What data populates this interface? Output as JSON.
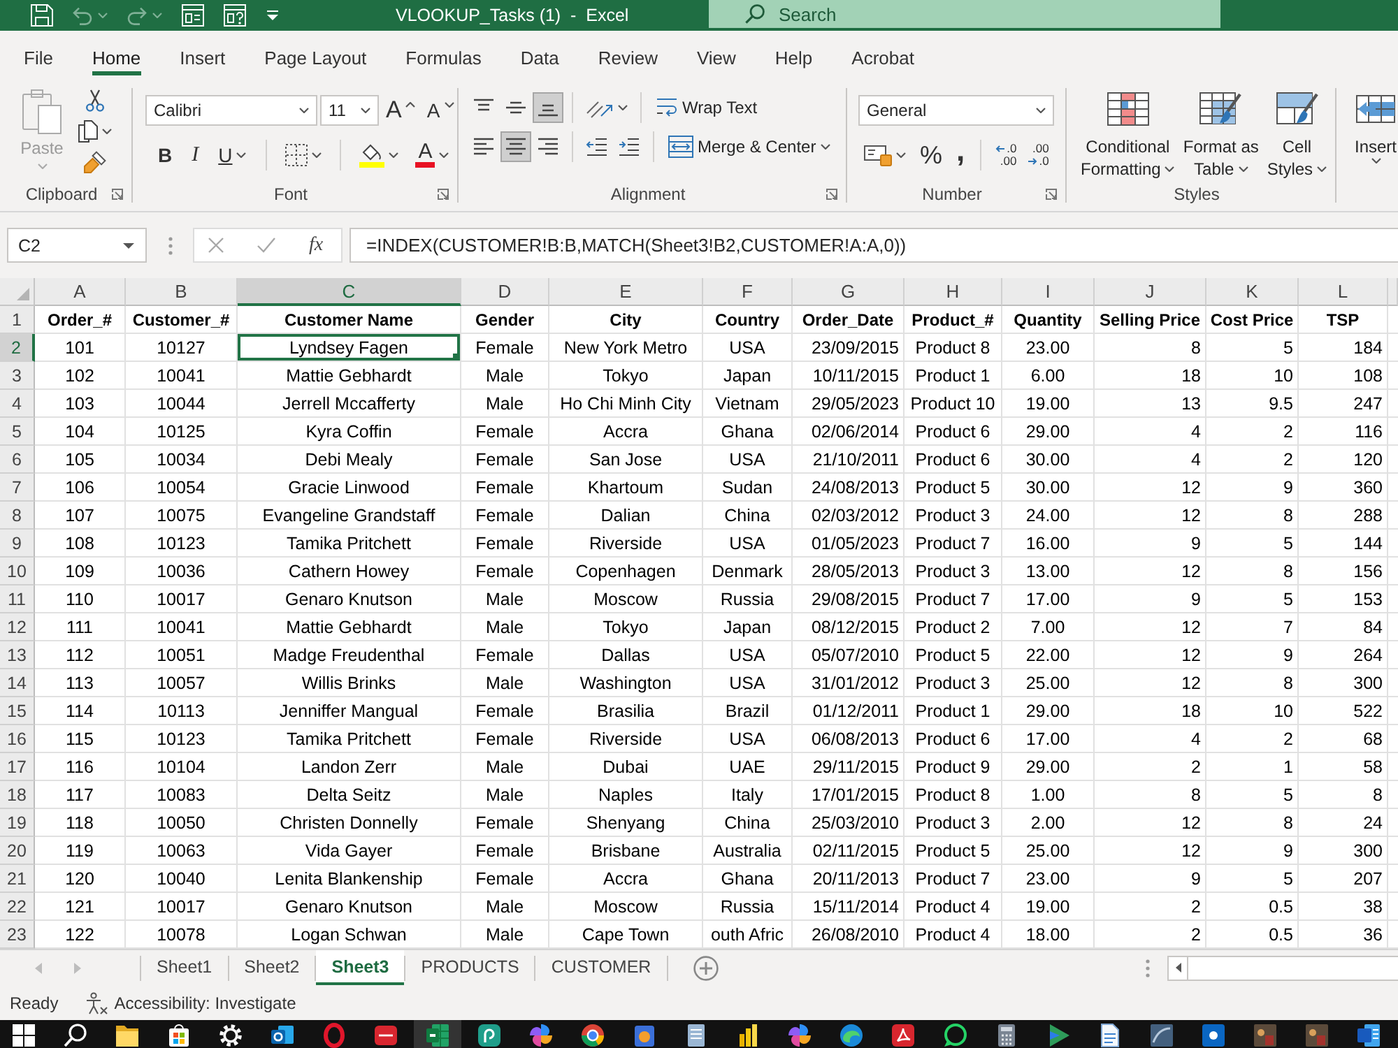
{
  "window": {
    "title": "VLOOKUP_Tasks (1)  -  Excel",
    "search": {
      "placeholder": "Search"
    }
  },
  "quick_access": [
    {
      "kind": "save",
      "disabled": false
    },
    {
      "kind": "undo",
      "disabled": true
    },
    {
      "kind": "redo",
      "disabled": true
    },
    {
      "kind": "form",
      "disabled": false
    },
    {
      "kind": "formquery",
      "disabled": false
    },
    {
      "kind": "customize",
      "disabled": false
    }
  ],
  "ribbon_tabs": [
    {
      "label": "File",
      "selected": false
    },
    {
      "label": "Home",
      "selected": true
    },
    {
      "label": "Insert",
      "selected": false
    },
    {
      "label": "Page Layout",
      "selected": false
    },
    {
      "label": "Formulas",
      "selected": false
    },
    {
      "label": "Data",
      "selected": false
    },
    {
      "label": "Review",
      "selected": false
    },
    {
      "label": "View",
      "selected": false
    },
    {
      "label": "Help",
      "selected": false
    },
    {
      "label": "Acrobat",
      "selected": false
    }
  ],
  "ribbon": {
    "clipboard": {
      "label": "Clipboard",
      "paste": {
        "label": "Paste",
        "disabled": true
      }
    },
    "font": {
      "label": "Font",
      "name": "Calibri",
      "size": "11",
      "grow": "A",
      "shrink": "A",
      "bold": "B",
      "italic": "I",
      "underline": "U",
      "font_color": "A"
    },
    "alignment": {
      "label": "Alignment",
      "vertical": [
        {
          "kind": "top",
          "selected": false
        },
        {
          "kind": "middle",
          "selected": false
        },
        {
          "kind": "bottom",
          "selected": true
        }
      ],
      "horizontal": [
        {
          "kind": "left",
          "selected": false
        },
        {
          "kind": "center",
          "selected": true
        },
        {
          "kind": "right",
          "selected": false
        }
      ],
      "wrap": "Wrap Text",
      "merge": "Merge & Center"
    },
    "number": {
      "label": "Number",
      "format": "General",
      "percent": "%",
      "comma": ",",
      "decimals": [
        {
          "kind": "increase",
          "lines": [
            {
              "text": ".0",
              "arrow": true
            },
            {
              "text": ".00",
              "arrow": false
            }
          ]
        },
        {
          "kind": "decrease",
          "lines": [
            {
              "text": ".00",
              "arrow": false
            },
            {
              "text": ".0",
              "arrow": true
            }
          ]
        }
      ]
    },
    "styles": {
      "label": "Styles",
      "items": [
        {
          "kind": "conditional",
          "lines": [
            "Conditional",
            "Formatting"
          ]
        },
        {
          "kind": "table",
          "lines": [
            "Format as",
            "Table"
          ]
        },
        {
          "kind": "cell",
          "lines": [
            "Cell",
            "Styles"
          ]
        }
      ]
    },
    "cells": {
      "insert": "Insert"
    }
  },
  "formula_bar": {
    "name_box": "C2",
    "cancel": {
      "disabled": true
    },
    "enter": {
      "disabled": true
    },
    "function": "fx",
    "formula": "=INDEX(CUSTOMER!B:B,MATCH(Sheet3!B2,CUSTOMER!A:A,0))"
  },
  "grid": {
    "columns": [
      {
        "letter": "A",
        "selected": false
      },
      {
        "letter": "B",
        "selected": false
      },
      {
        "letter": "C",
        "selected": true
      },
      {
        "letter": "D",
        "selected": false
      },
      {
        "letter": "E",
        "selected": false
      },
      {
        "letter": "F",
        "selected": false
      },
      {
        "letter": "G",
        "selected": false
      },
      {
        "letter": "H",
        "selected": false
      },
      {
        "letter": "I",
        "selected": false
      },
      {
        "letter": "J",
        "selected": false
      },
      {
        "letter": "K",
        "selected": false
      },
      {
        "letter": "L",
        "selected": false
      }
    ],
    "rows": [
      {
        "number": "1",
        "selected": false,
        "kind": "header",
        "cells": [
          "Order_#",
          "Customer_#",
          "Customer Name",
          "Gender",
          "City",
          "Country",
          "Order_Date",
          "Product_#",
          "Quantity",
          "Selling Price",
          "Cost Price",
          "TSP"
        ]
      },
      {
        "number": "2",
        "selected": true,
        "kind": "data",
        "cells": [
          "101",
          "10127",
          "Lyndsey Fagen",
          "Female",
          "New York Metro",
          "USA",
          "23/09/2015",
          "Product 8",
          "23.00",
          "8",
          "5",
          "184"
        ]
      },
      {
        "number": "3",
        "selected": false,
        "kind": "data",
        "cells": [
          "102",
          "10041",
          "Mattie Gebhardt",
          "Male",
          "Tokyo",
          "Japan",
          "10/11/2015",
          "Product 1",
          "6.00",
          "18",
          "10",
          "108"
        ]
      },
      {
        "number": "4",
        "selected": false,
        "kind": "data",
        "cells": [
          "103",
          "10044",
          "Jerrell Mccafferty",
          "Male",
          "Ho Chi Minh City",
          "Vietnam",
          "29/05/2023",
          "Product 10",
          "19.00",
          "13",
          "9.5",
          "247"
        ]
      },
      {
        "number": "5",
        "selected": false,
        "kind": "data",
        "cells": [
          "104",
          "10125",
          "Kyra Coffin",
          "Female",
          "Accra",
          "Ghana",
          "02/06/2014",
          "Product 6",
          "29.00",
          "4",
          "2",
          "116"
        ]
      },
      {
        "number": "6",
        "selected": false,
        "kind": "data",
        "cells": [
          "105",
          "10034",
          "Debi Mealy",
          "Female",
          "San Jose",
          "USA",
          "21/10/2011",
          "Product 6",
          "30.00",
          "4",
          "2",
          "120"
        ]
      },
      {
        "number": "7",
        "selected": false,
        "kind": "data",
        "cells": [
          "106",
          "10054",
          "Gracie Linwood",
          "Female",
          "Khartoum",
          "Sudan",
          "24/08/2013",
          "Product 5",
          "30.00",
          "12",
          "9",
          "360"
        ]
      },
      {
        "number": "8",
        "selected": false,
        "kind": "data",
        "cells": [
          "107",
          "10075",
          "Evangeline Grandstaff",
          "Female",
          "Dalian",
          "China",
          "02/03/2012",
          "Product 3",
          "24.00",
          "12",
          "8",
          "288"
        ]
      },
      {
        "number": "9",
        "selected": false,
        "kind": "data",
        "cells": [
          "108",
          "10123",
          "Tamika Pritchett",
          "Female",
          "Riverside",
          "USA",
          "01/05/2023",
          "Product 7",
          "16.00",
          "9",
          "5",
          "144"
        ]
      },
      {
        "number": "10",
        "selected": false,
        "kind": "data",
        "cells": [
          "109",
          "10036",
          "Cathern Howey",
          "Female",
          "Copenhagen",
          "Denmark",
          "28/05/2013",
          "Product 3",
          "13.00",
          "12",
          "8",
          "156"
        ]
      },
      {
        "number": "11",
        "selected": false,
        "kind": "data",
        "cells": [
          "110",
          "10017",
          "Genaro Knutson",
          "Male",
          "Moscow",
          "Russia",
          "29/08/2015",
          "Product 7",
          "17.00",
          "9",
          "5",
          "153"
        ]
      },
      {
        "number": "12",
        "selected": false,
        "kind": "data",
        "cells": [
          "111",
          "10041",
          "Mattie Gebhardt",
          "Male",
          "Tokyo",
          "Japan",
          "08/12/2015",
          "Product 2",
          "7.00",
          "12",
          "7",
          "84"
        ]
      },
      {
        "number": "13",
        "selected": false,
        "kind": "data",
        "cells": [
          "112",
          "10051",
          "Madge Freudenthal",
          "Female",
          "Dallas",
          "USA",
          "05/07/2010",
          "Product 5",
          "22.00",
          "12",
          "9",
          "264"
        ]
      },
      {
        "number": "14",
        "selected": false,
        "kind": "data",
        "cells": [
          "113",
          "10057",
          "Willis Brinks",
          "Male",
          "Washington",
          "USA",
          "31/01/2012",
          "Product 3",
          "25.00",
          "12",
          "8",
          "300"
        ]
      },
      {
        "number": "15",
        "selected": false,
        "kind": "data",
        "cells": [
          "114",
          "10113",
          "Jenniffer Mangual",
          "Female",
          "Brasilia",
          "Brazil",
          "01/12/2011",
          "Product 1",
          "29.00",
          "18",
          "10",
          "522"
        ]
      },
      {
        "number": "16",
        "selected": false,
        "kind": "data",
        "cells": [
          "115",
          "10123",
          "Tamika Pritchett",
          "Female",
          "Riverside",
          "USA",
          "06/08/2013",
          "Product 6",
          "17.00",
          "4",
          "2",
          "68"
        ]
      },
      {
        "number": "17",
        "selected": false,
        "kind": "data",
        "cells": [
          "116",
          "10104",
          "Landon Zerr",
          "Male",
          "Dubai",
          "UAE",
          "29/11/2015",
          "Product 9",
          "29.00",
          "2",
          "1",
          "58"
        ]
      },
      {
        "number": "18",
        "selected": false,
        "kind": "data",
        "cells": [
          "117",
          "10083",
          "Delta Seitz",
          "Male",
          "Naples",
          "Italy",
          "17/01/2015",
          "Product 8",
          "1.00",
          "8",
          "5",
          "8"
        ]
      },
      {
        "number": "19",
        "selected": false,
        "kind": "data",
        "cells": [
          "118",
          "10050",
          "Christen Donnelly",
          "Female",
          "Shenyang",
          "China",
          "25/03/2010",
          "Product 3",
          "2.00",
          "12",
          "8",
          "24"
        ]
      },
      {
        "number": "20",
        "selected": false,
        "kind": "data",
        "cells": [
          "119",
          "10063",
          "Vida Gayer",
          "Female",
          "Brisbane",
          "Australia",
          "02/11/2015",
          "Product 5",
          "25.00",
          "12",
          "9",
          "300"
        ]
      },
      {
        "number": "21",
        "selected": false,
        "kind": "data",
        "cells": [
          "120",
          "10040",
          "Lenita Blankenship",
          "Female",
          "Accra",
          "Ghana",
          "20/11/2013",
          "Product 7",
          "23.00",
          "9",
          "5",
          "207"
        ]
      },
      {
        "number": "22",
        "selected": false,
        "kind": "data",
        "cells": [
          "121",
          "10017",
          "Genaro Knutson",
          "Male",
          "Moscow",
          "Russia",
          "15/11/2014",
          "Product 4",
          "19.00",
          "2",
          "0.5",
          "38"
        ]
      },
      {
        "number": "23",
        "selected": false,
        "kind": "data",
        "cells": [
          "122",
          "10078",
          "Logan Schwan",
          "Male",
          "Cape Town",
          "outh Afric",
          "26/08/2010",
          "Product 4",
          "18.00",
          "2",
          "0.5",
          "36"
        ]
      }
    ]
  },
  "sheet_tabs": {
    "navigation": [
      {
        "kind": "previous",
        "disabled": true
      },
      {
        "kind": "next",
        "disabled": true
      }
    ],
    "tabs": [
      {
        "label": "Sheet1",
        "selected": false
      },
      {
        "label": "Sheet2",
        "selected": false
      },
      {
        "label": "Sheet3",
        "selected": true
      },
      {
        "label": "PRODUCTS",
        "selected": false
      },
      {
        "label": "CUSTOMER",
        "selected": false
      }
    ]
  },
  "status_bar": {
    "mode": "Ready",
    "accessibility": "Accessibility: Investigate"
  },
  "taskbar": [
    {
      "kind": "squares",
      "active": false
    },
    {
      "kind": "search",
      "active": false
    },
    {
      "kind": "folder",
      "active": false
    },
    {
      "kind": "bag",
      "active": false
    },
    {
      "kind": "gear",
      "active": false
    },
    {
      "kind": "envelope",
      "active": false
    },
    {
      "kind": "ring",
      "active": false
    },
    {
      "kind": "badge",
      "active": false
    },
    {
      "kind": "grid",
      "active": true
    },
    {
      "kind": "spiral",
      "active": false
    },
    {
      "kind": "petals",
      "active": false
    },
    {
      "kind": "wheel",
      "active": false
    },
    {
      "kind": "basket",
      "active": false
    },
    {
      "kind": "notepad",
      "active": false
    },
    {
      "kind": "bars",
      "active": false
    },
    {
      "kind": "petals",
      "active": false
    },
    {
      "kind": "wave",
      "active": false
    },
    {
      "kind": "fold",
      "active": false
    },
    {
      "kind": "chat",
      "active": false
    },
    {
      "kind": "calculator",
      "active": false
    },
    {
      "kind": "arrow",
      "active": false
    },
    {
      "kind": "page",
      "active": false
    },
    {
      "kind": "fin",
      "active": false
    },
    {
      "kind": "dot",
      "active": false
    },
    {
      "kind": "picture",
      "active": false
    },
    {
      "kind": "picture",
      "active": false
    },
    {
      "kind": "book",
      "active": false
    }
  ]
}
